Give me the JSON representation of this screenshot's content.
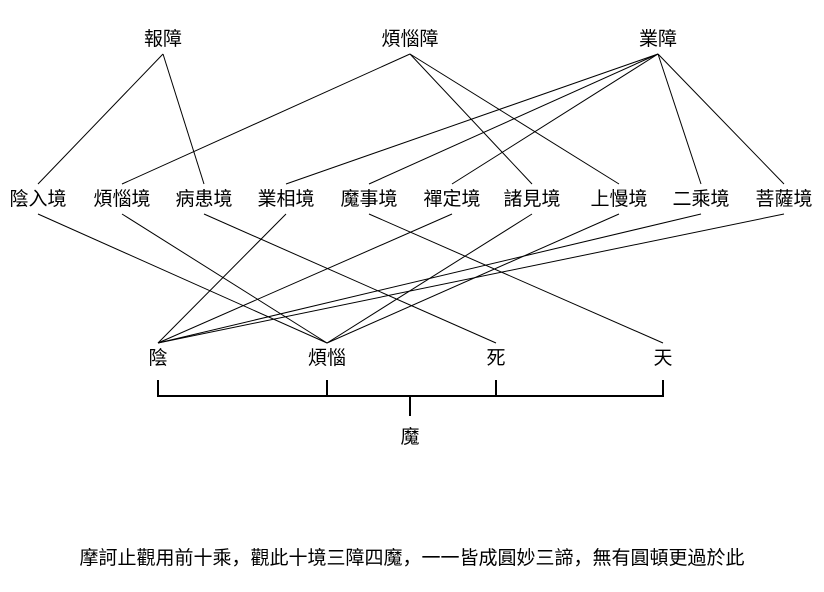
{
  "obstacles": [
    {
      "id": "retribution",
      "label": "報障"
    },
    {
      "id": "afflictions",
      "label": "煩惱障"
    },
    {
      "id": "karma",
      "label": "業障"
    }
  ],
  "realms": [
    {
      "id": "skandhas",
      "label": "陰入境"
    },
    {
      "id": "afflictions",
      "label": "煩惱境"
    },
    {
      "id": "illness",
      "label": "病患境"
    },
    {
      "id": "karmic-signs",
      "label": "業相境"
    },
    {
      "id": "demonic",
      "label": "魔事境"
    },
    {
      "id": "dhyana",
      "label": "禪定境"
    },
    {
      "id": "views",
      "label": "諸見境"
    },
    {
      "id": "arrogance",
      "label": "上慢境"
    },
    {
      "id": "two-vehicles",
      "label": "二乘境"
    },
    {
      "id": "bodhisattva",
      "label": "菩薩境"
    }
  ],
  "demons": [
    {
      "id": "skandha",
      "label": "陰"
    },
    {
      "id": "affliction",
      "label": "煩惱"
    },
    {
      "id": "death",
      "label": "死"
    },
    {
      "id": "heaven",
      "label": "天"
    }
  ],
  "root": {
    "label": "魔"
  },
  "links_obstacles_to_realms": [
    [
      "retribution",
      "skandhas"
    ],
    [
      "retribution",
      "illness"
    ],
    [
      "afflictions",
      "afflictions"
    ],
    [
      "afflictions",
      "views"
    ],
    [
      "afflictions",
      "arrogance"
    ],
    [
      "karma",
      "karmic-signs"
    ],
    [
      "karma",
      "demonic"
    ],
    [
      "karma",
      "dhyana"
    ],
    [
      "karma",
      "two-vehicles"
    ],
    [
      "karma",
      "bodhisattva"
    ]
  ],
  "links_realms_to_demons": [
    [
      "skandhas",
      "affliction"
    ],
    [
      "afflictions",
      "affliction"
    ],
    [
      "illness",
      "death"
    ],
    [
      "karmic-signs",
      "skandha"
    ],
    [
      "demonic",
      "heaven"
    ],
    [
      "dhyana",
      "skandha"
    ],
    [
      "views",
      "affliction"
    ],
    [
      "arrogance",
      "affliction"
    ],
    [
      "two-vehicles",
      "skandha"
    ],
    [
      "bodhisattva",
      "skandha"
    ]
  ],
  "caption": "摩訶止觀用前十乘，觀此十境三障四魔，一一皆成圓妙三諦，無有圓頓更過於此"
}
